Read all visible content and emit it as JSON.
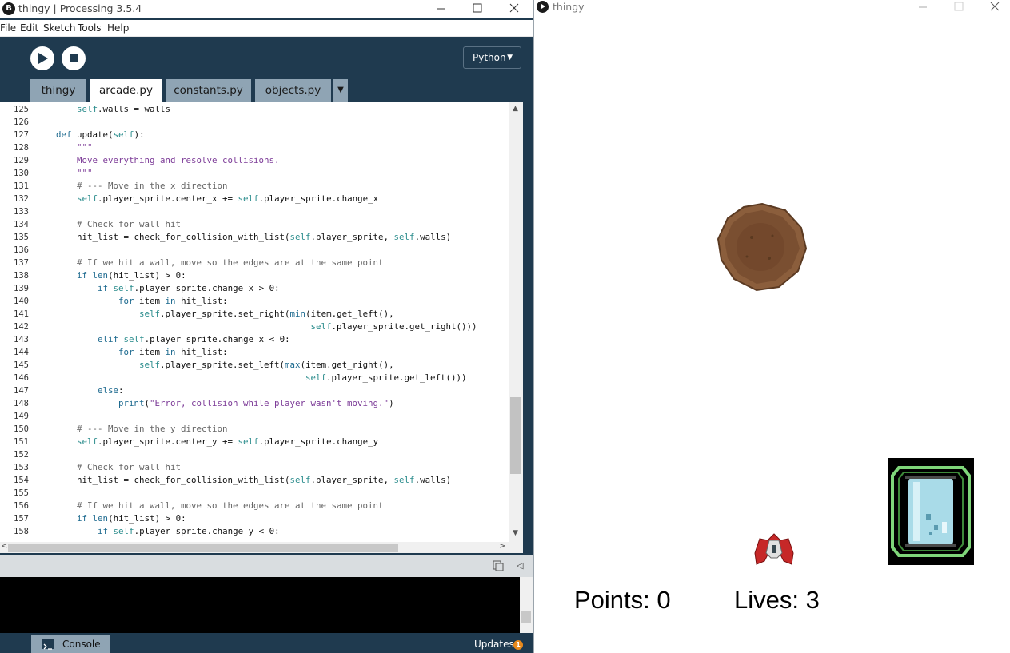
{
  "ide": {
    "title": "thingy | Processing 3.5.4",
    "app_icon_glyph": "B",
    "menu": [
      "File",
      "Edit",
      "Sketch",
      "Tools",
      "Help"
    ],
    "mode": "Python",
    "tabs": [
      "thingy",
      "arcade.py",
      "constants.py",
      "objects.py"
    ],
    "active_tab": "arcade.py",
    "tab_menu_glyph": "▼",
    "console_label": "Console",
    "updates_label": "Updates",
    "updates_count": "1"
  },
  "editor": {
    "lines": [
      {
        "num": "125",
        "code": "        self.walls = walls"
      },
      {
        "num": "126",
        "code": ""
      },
      {
        "num": "127",
        "code": "    def update(self):"
      },
      {
        "num": "128",
        "code": "        \"\"\""
      },
      {
        "num": "129",
        "code": "        Move everything and resolve collisions."
      },
      {
        "num": "130",
        "code": "        \"\"\""
      },
      {
        "num": "131",
        "code": "        # --- Move in the x direction"
      },
      {
        "num": "132",
        "code": "        self.player_sprite.center_x += self.player_sprite.change_x"
      },
      {
        "num": "133",
        "code": ""
      },
      {
        "num": "134",
        "code": "        # Check for wall hit"
      },
      {
        "num": "135",
        "code": "        hit_list = check_for_collision_with_list(self.player_sprite, self.walls)"
      },
      {
        "num": "136",
        "code": ""
      },
      {
        "num": "137",
        "code": "        # If we hit a wall, move so the edges are at the same point"
      },
      {
        "num": "138",
        "code": "        if len(hit_list) > 0:"
      },
      {
        "num": "139",
        "code": "            if self.player_sprite.change_x > 0:"
      },
      {
        "num": "140",
        "code": "                for item in hit_list:"
      },
      {
        "num": "141",
        "code": "                    self.player_sprite.set_right(min(item.get_left(),"
      },
      {
        "num": "142",
        "code": "                                                     self.player_sprite.get_right()))"
      },
      {
        "num": "143",
        "code": "            elif self.player_sprite.change_x < 0:"
      },
      {
        "num": "144",
        "code": "                for item in hit_list:"
      },
      {
        "num": "145",
        "code": "                    self.player_sprite.set_left(max(item.get_right(),"
      },
      {
        "num": "146",
        "code": "                                                    self.player_sprite.get_left()))"
      },
      {
        "num": "147",
        "code": "            else:"
      },
      {
        "num": "148",
        "code": "                print(\"Error, collision while player wasn't moving.\")"
      },
      {
        "num": "149",
        "code": ""
      },
      {
        "num": "150",
        "code": "        # --- Move in the y direction"
      },
      {
        "num": "151",
        "code": "        self.player_sprite.center_y += self.player_sprite.change_y"
      },
      {
        "num": "152",
        "code": ""
      },
      {
        "num": "153",
        "code": "        # Check for wall hit"
      },
      {
        "num": "154",
        "code": "        hit_list = check_for_collision_with_list(self.player_sprite, self.walls)"
      },
      {
        "num": "155",
        "code": ""
      },
      {
        "num": "156",
        "code": "        # If we hit a wall, move so the edges are at the same point"
      },
      {
        "num": "157",
        "code": "        if len(hit_list) > 0:"
      },
      {
        "num": "158",
        "code": "            if self.player_sprite.change_y < 0:"
      }
    ],
    "vertical_scroll_fraction": 0.8
  },
  "sketch": {
    "title": "thingy",
    "points_text": "Points: 0",
    "lives_text": "Lives: 3",
    "sprites": [
      "asteroid-sprite",
      "player-ship-sprite",
      "capsule-pickup-sprite"
    ]
  },
  "colors": {
    "ide_background": "#1f3a4f",
    "tab_inactive": "#8fa4b4",
    "updates_badge": "#e8891c",
    "asteroid": "#8b5e3c",
    "capsule": "#a9dbe8",
    "capsule_frame": "#7fd67a",
    "ship": "#c62828"
  },
  "icons": {
    "run": "play-icon",
    "stop": "stop-icon",
    "minimize": "minimize-icon",
    "maximize": "maximize-icon",
    "close": "close-icon",
    "console": "console-icon",
    "copy": "copy-icon",
    "collapse": "collapse-arrow-icon"
  }
}
